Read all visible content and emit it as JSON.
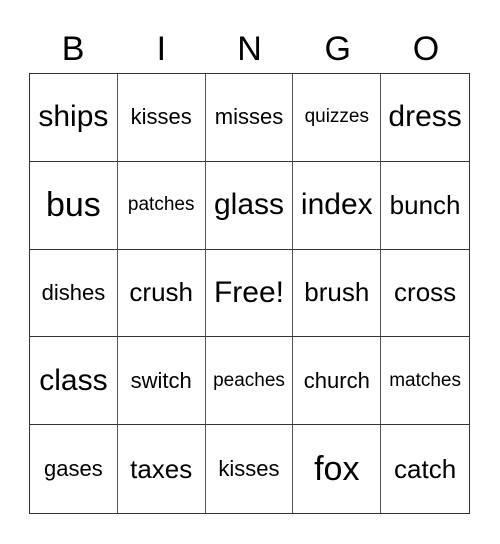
{
  "header": [
    "B",
    "I",
    "N",
    "G",
    "O"
  ],
  "rows": [
    [
      {
        "text": "ships",
        "size": "l"
      },
      {
        "text": "kisses",
        "size": "s"
      },
      {
        "text": "misses",
        "size": "s"
      },
      {
        "text": "quizzes",
        "size": "xs"
      },
      {
        "text": "dress",
        "size": "l"
      }
    ],
    [
      {
        "text": "bus",
        "size": "xl"
      },
      {
        "text": "patches",
        "size": "xs"
      },
      {
        "text": "glass",
        "size": "l"
      },
      {
        "text": "index",
        "size": "l"
      },
      {
        "text": "bunch",
        "size": "m"
      }
    ],
    [
      {
        "text": "dishes",
        "size": "s"
      },
      {
        "text": "crush",
        "size": "m"
      },
      {
        "text": "Free!",
        "size": "l"
      },
      {
        "text": "brush",
        "size": "m"
      },
      {
        "text": "cross",
        "size": "m"
      }
    ],
    [
      {
        "text": "class",
        "size": "l"
      },
      {
        "text": "switch",
        "size": "s"
      },
      {
        "text": "peaches",
        "size": "xs"
      },
      {
        "text": "church",
        "size": "s"
      },
      {
        "text": "matches",
        "size": "xs"
      }
    ],
    [
      {
        "text": "gases",
        "size": "s"
      },
      {
        "text": "taxes",
        "size": "m"
      },
      {
        "text": "kisses",
        "size": "s"
      },
      {
        "text": "fox",
        "size": "xl"
      },
      {
        "text": "catch",
        "size": "m"
      }
    ]
  ]
}
